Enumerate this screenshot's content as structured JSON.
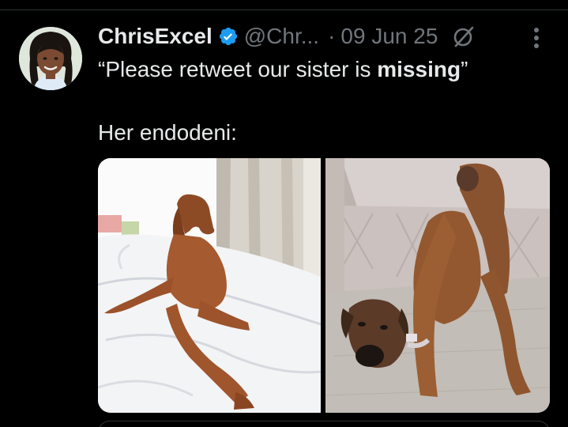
{
  "tweet": {
    "display_name": "ChrisExcel",
    "handle": "@Chr...",
    "separator": "·",
    "date": "09 Jun 25",
    "text_open": "“Please retweet our sister is ",
    "text_bold": "missing",
    "text_close": "”",
    "text_line2": "Her endodeni:",
    "verified_icon": "verified-badge-icon",
    "grok_icon": "grok-icon",
    "more_icon": "more-options-icon"
  },
  "colors": {
    "background": "#000000",
    "primary_text": "#e7e9ea",
    "secondary_text": "#71767b",
    "verified": "#1d9bf0"
  }
}
